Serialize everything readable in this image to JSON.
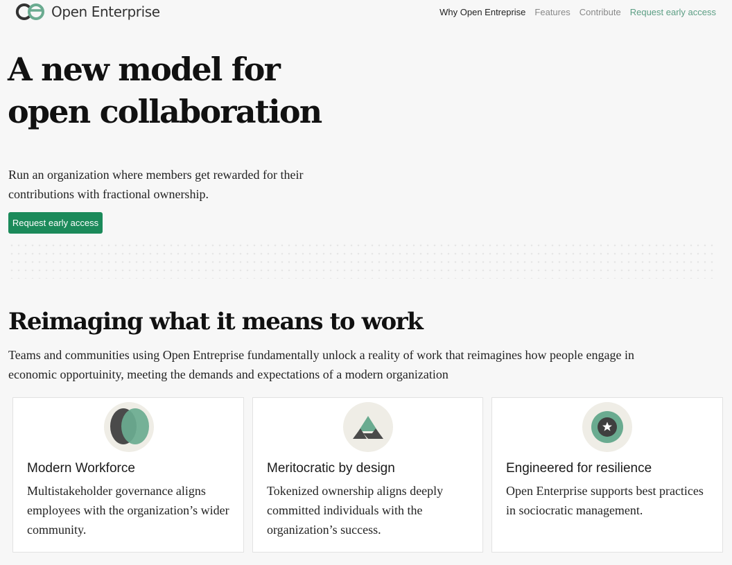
{
  "nav": {
    "brand": "Open Enterprise",
    "links": [
      "Why Open Entreprise",
      "Features",
      "Contribute",
      "Request early access"
    ]
  },
  "hero": {
    "title_line1": "A new model for",
    "title_line2": "open collaboration",
    "subtitle": "Run an organization where members get rewarded for their contributions with fractional ownership.",
    "cta_label": "Request early access"
  },
  "section": {
    "title": "Reimaging what it means to work",
    "description": "Teams and communities using Open Entreprise fundamentally unlock a reality of work that reimagines how people engage in economic opportuinity, meeting the demands and expectations of a modern organization"
  },
  "cards": [
    {
      "icon": "overlapping-circles-icon",
      "title": "Modern Workforce",
      "text": "Multistakeholder governance aligns employees with the organization’s wider community."
    },
    {
      "icon": "mountains-icon",
      "title": "Meritocratic by design",
      "text": "Tokenized ownership aligns deeply committed individuals with the organization’s success."
    },
    {
      "icon": "star-badge-icon",
      "title": "Engineered for resilience",
      "text": "Open Enterprise supports best practices in sociocratic management."
    }
  ],
  "colors": {
    "accent_green": "#1b8a5a",
    "soft_green": "#6aab90",
    "dark_gray": "#4a4a4a",
    "icon_bg": "#efede6"
  }
}
